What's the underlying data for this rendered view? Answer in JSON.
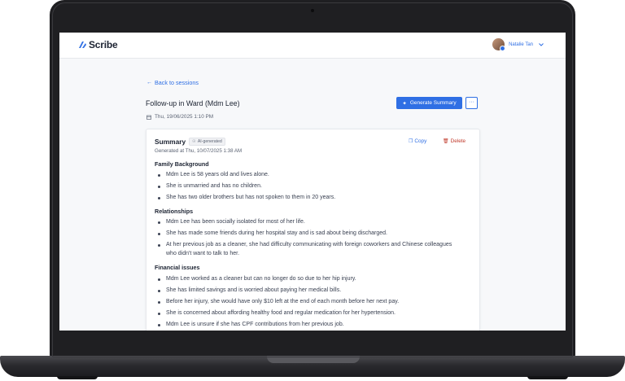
{
  "app": {
    "logo_text": "Scribe"
  },
  "user": {
    "name": "Natalie Tan"
  },
  "nav": {
    "back_label": "Back to sessions"
  },
  "session": {
    "title": "Follow-up in Ward (Mdm Lee)",
    "date": "Thu, 19/06/2025 1:10 PM"
  },
  "actions": {
    "generate_label": "Generate Summary",
    "more_label": "···"
  },
  "summary": {
    "title": "Summary",
    "badge": "AI-generated",
    "copy_label": "Copy",
    "delete_label": "Delete",
    "generated_at": "Generated at Thu, 10/07/2025 1:38 AM",
    "sections": [
      {
        "heading": "Family Background",
        "items": [
          "Mdm Lee is 58 years old and lives alone.",
          "She is unmarried and has no children.",
          "She has two older brothers but has not spoken to them in 20 years."
        ]
      },
      {
        "heading": "Relationships",
        "items": [
          "Mdm Lee has been socially isolated for most of her life.",
          "She has made some friends during her hospital stay and is sad about being discharged.",
          "At her previous job as a cleaner, she had difficulty communicating with foreign coworkers and Chinese colleagues who didn't want to talk to her."
        ]
      },
      {
        "heading": "Financial issues",
        "items": [
          "Mdm Lee worked as a cleaner but can no longer do so due to her hip injury.",
          "She has limited savings and is worried about paying her medical bills.",
          "Before her injury, she would have only $10 left at the end of each month before her next pay.",
          "She is concerned about affording healthy food and regular medication for her hypertension.",
          "Mdm Lee is unsure if she has CPF contributions from her previous job."
        ]
      }
    ]
  },
  "colors": {
    "accent": "#2f6fe4",
    "danger": "#c0392b",
    "text": "#1d2433"
  }
}
